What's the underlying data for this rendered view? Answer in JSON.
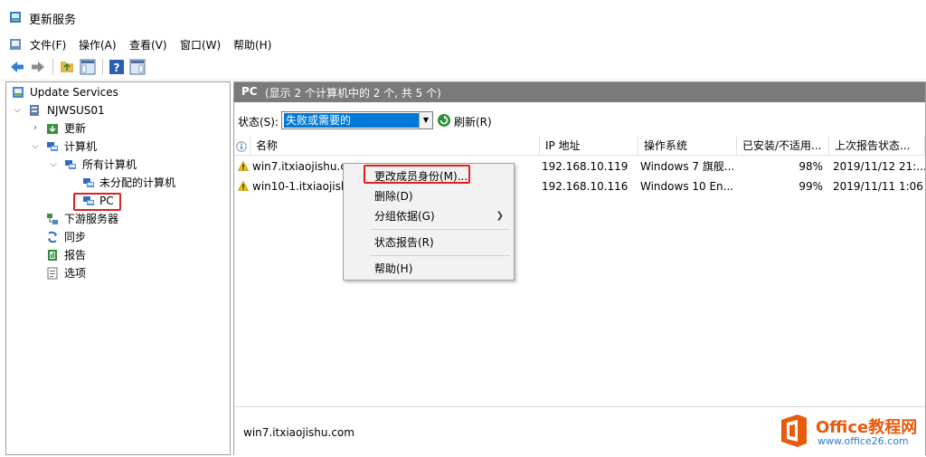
{
  "window": {
    "title": "更新服务",
    "icon": "wsus-console-icon"
  },
  "menubar": {
    "items": [
      "文件(F)",
      "操作(A)",
      "查看(V)",
      "窗口(W)",
      "帮助(H)"
    ]
  },
  "toolbar": {
    "buttons": [
      "back-icon",
      "forward-icon",
      "up-folder-icon",
      "show-hide-tree-icon",
      "help-icon",
      "show-action-pane-icon"
    ]
  },
  "tree": {
    "nodes": [
      {
        "label": "Update Services",
        "icon": "update-services-icon"
      },
      {
        "label": "NJWSUS01",
        "icon": "server-icon"
      },
      {
        "label": "更新",
        "icon": "updates-icon"
      },
      {
        "label": "计算机",
        "icon": "computers-icon"
      },
      {
        "label": "所有计算机",
        "icon": "computer-group-icon"
      },
      {
        "label": "未分配的计算机",
        "icon": "computer-group-icon"
      },
      {
        "label": "PC",
        "icon": "computer-group-icon"
      },
      {
        "label": "下游服务器",
        "icon": "downstream-servers-icon"
      },
      {
        "label": "同步",
        "icon": "sync-icon"
      },
      {
        "label": "报告",
        "icon": "reports-icon"
      },
      {
        "label": "选项",
        "icon": "options-icon"
      }
    ]
  },
  "pane": {
    "header_name": "PC",
    "header_sub": "(显示 2 个计算机中的 2 个, 共 5 个)",
    "filter_label": "状态(S):",
    "filter_value": "失败或需要的",
    "refresh_label": "刷新(R)"
  },
  "table": {
    "columns": [
      "名称",
      "IP 地址",
      "操作系统",
      "已安装/不适用...",
      "上次报告状态..."
    ],
    "rows": [
      {
        "name": "win7.itxiaojishu.com",
        "ip": "192.168.10.119",
        "os": "Windows 7 旗舰...",
        "installed": "98%",
        "last_report": "2019/11/12 21:..."
      },
      {
        "name": "win10-1.itxiaojishu.com",
        "ip": "192.168.10.116",
        "os": "Windows 10 En...",
        "installed": "99%",
        "last_report": "2019/11/11 1:06"
      }
    ]
  },
  "context_menu": {
    "items": [
      "更改成员身份(M)...",
      "删除(D)",
      "分组依据(G)",
      "状态报告(R)",
      "帮助(H)"
    ]
  },
  "detail": {
    "selected_name": "win7.itxiaojishu.com"
  },
  "watermark": {
    "brand": "Office教程网",
    "site": "www.office26.com"
  },
  "colors": {
    "header_bg": "#7a7a7a",
    "selection_blue": "#0078d7",
    "highlight_red": "#e02020",
    "brand_orange": "#e85a0c"
  }
}
